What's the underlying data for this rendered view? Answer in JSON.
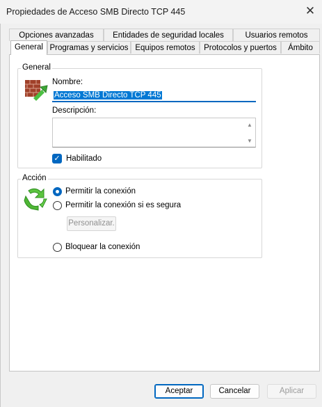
{
  "window": {
    "title": "Propiedades de Acceso SMB Directo TCP 445"
  },
  "tabs_row1": [
    "Opciones avanzadas",
    "Entidades de seguridad locales",
    "Usuarios remotos"
  ],
  "tabs_row2": [
    "General",
    "Programas y servicios",
    "Equipos remotos",
    "Protocolos y puertos",
    "Ámbito"
  ],
  "general": {
    "group_label": "General",
    "name_label": "Nombre:",
    "name_value": "Acceso SMB Directo TCP 445",
    "description_label": "Descripción:",
    "description_value": "",
    "enabled_label": "Habilitado"
  },
  "action": {
    "group_label": "Acción",
    "allow": "Permitir la conexión",
    "allow_secure": "Permitir la conexión si es segura",
    "customize": "Personalizar.",
    "block": "Bloquear la conexión"
  },
  "footer": {
    "accept": "Aceptar",
    "cancel": "Cancelar",
    "apply": "Aplicar"
  },
  "colors": {
    "accent": "#0067c0",
    "selection": "#0078d4"
  }
}
